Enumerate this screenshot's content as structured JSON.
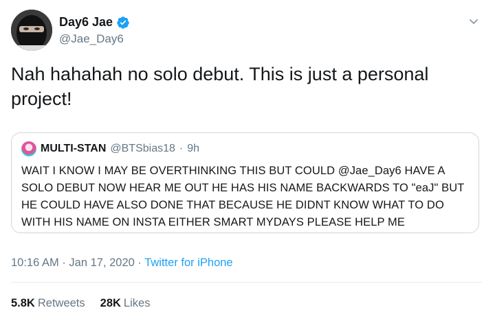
{
  "tweet": {
    "display_name": "Day6 Jae",
    "handle": "@Jae_Day6",
    "verified": true,
    "text": "Nah hahahah no solo debut. This is just a personal project!",
    "time": "10:16 AM",
    "date": "Jan 17, 2020",
    "separator": "·",
    "source": "Twitter for iPhone"
  },
  "quote": {
    "name": "MULTI-STAN",
    "handle": "@BTSbias18",
    "age": "9h",
    "text": "WAIT I KNOW I MAY BE OVERTHINKING THIS BUT COULD @Jae_Day6 HAVE A SOLO DEBUT NOW HEAR ME OUT HE HAS HIS NAME BACKWARDS TO \"eaJ\" BUT HE COULD HAVE ALSO DONE THAT BECAUSE HE DIDNT KNOW WHAT TO DO WITH HIS NAME ON INSTA EITHER SMART MYDAYS PLEASE HELP ME"
  },
  "stats": {
    "retweets_count": "5.8K",
    "retweets_label": "Retweets",
    "likes_count": "28K",
    "likes_label": "Likes"
  },
  "colors": {
    "accent": "#1da1f2",
    "secondary_text": "#657786",
    "border": "#ccd6dd"
  },
  "icons": {
    "verified": "verified-badge-icon",
    "menu": "chevron-down-icon"
  }
}
